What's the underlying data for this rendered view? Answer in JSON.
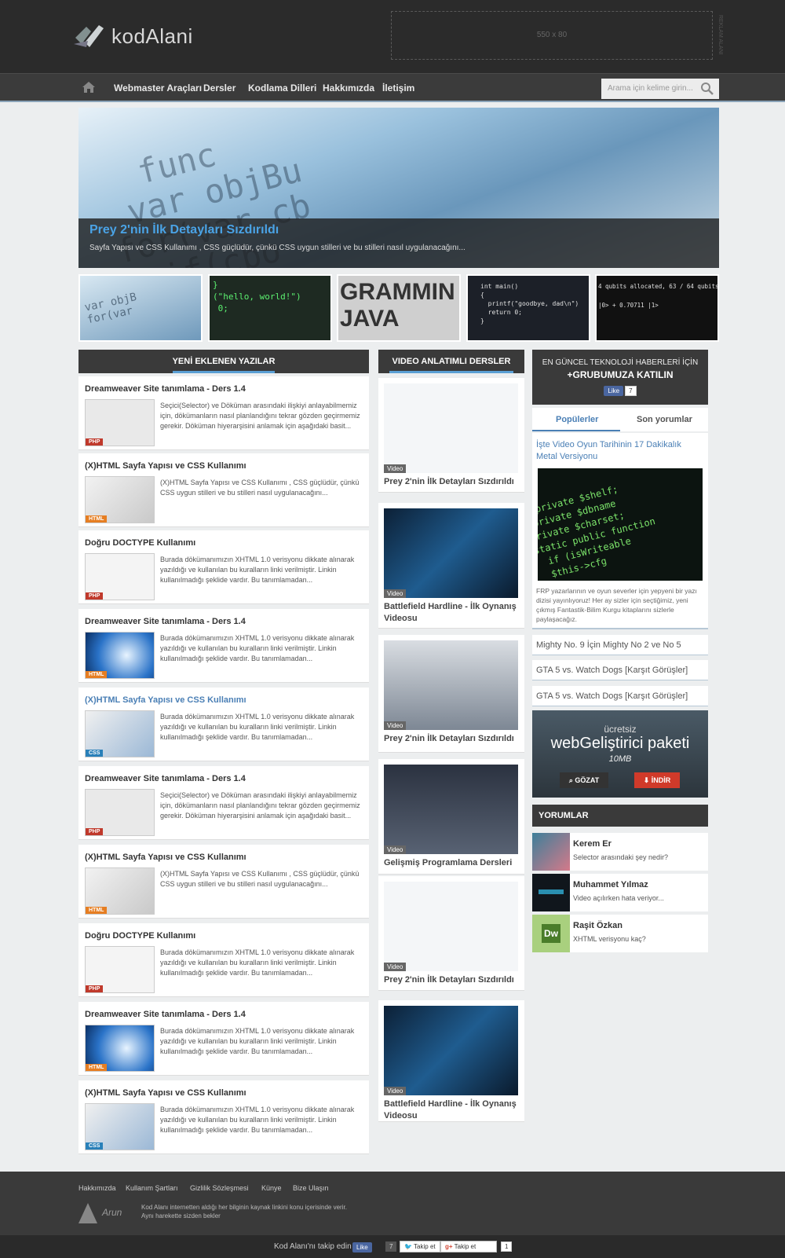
{
  "header": {
    "logo_text": "kodAlani",
    "ad_text": "550 x 80",
    "ad_side": "REKLAM ALANI"
  },
  "nav": {
    "items": [
      "Webmaster Araçları",
      "Dersler",
      "Kodlama Dilleri",
      "Hakkımızda",
      "İletişim"
    ],
    "search_placeholder": "Arama için kelime girin..."
  },
  "slider": {
    "title": "Prey 2'nin İlk Detayları Sızdırıldı",
    "desc": "Sayfa Yapısı ve CSS Kullanımı , CSS güçlüdür, çünkü CSS uygun stilleri ve bu stilleri nasıl uygulanacağını..."
  },
  "thumbs": [
    {
      "text": "var objB\nfor(var"
    },
    {
      "text": "}\n(\"hello, world!\")\n 0;"
    },
    {
      "text": "GRAMMIN\nJAVA"
    },
    {
      "text": "int main()\n{\n  printf(\"goodbye, dad\\n\")\n  return 0;\n}"
    },
    {
      "text": "4 qubits allocated, 63 / 64 qubits\n\n|0> + 0.70711 |1>"
    }
  ],
  "posts_panel": {
    "title": "YENİ EKLENEN YAZILAR"
  },
  "posts": [
    {
      "title": "Dreamweaver Site tanımlama - Ders 1.4",
      "desc": "Seçici(Selector) ve Döküman arasındaki ilişkiyi anlayabilmemiz için, dökümanların nasıl planlandığını tekrar gözden geçirmemiz gerekir. Döküman hiyerarşisini anlamak için aşağıdaki basit...",
      "tag": "PHP"
    },
    {
      "title": "(X)HTML Sayfa Yapısı ve CSS Kullanımı",
      "desc": "(X)HTML Sayfa Yapısı ve CSS Kullanımı , CSS güçlüdür, çünkü CSS uygun stilleri ve bu stilleri nasıl uygulanacağını...",
      "tag": "HTML"
    },
    {
      "title": "Doğru DOCTYPE Kullanımı",
      "desc": "Burada dökümanımızın XHTML 1.0 verisyonu dikkate alınarak yazıldığı ve kullanılan bu kuralların linki verilmiştir. Linkin kullanılmadığı şeklide vardır. Bu tanımlamadan...",
      "tag": "PHP"
    },
    {
      "title": "Dreamweaver Site tanımlama - Ders 1.4",
      "desc": "Burada dökümanımızın XHTML 1.0 verisyonu dikkate alınarak yazıldığı ve kullanılan bu kuralların linki verilmiştir. Linkin kullanılmadığı şeklide vardır. Bu tanımlamadan...",
      "tag": "HTML"
    },
    {
      "title": "(X)HTML Sayfa Yapısı ve CSS Kullanımı",
      "desc": "Burada dökümanımızın XHTML 1.0 verisyonu dikkate alınarak yazıldığı ve kullanılan bu kuralların linki verilmiştir. Linkin kullanılmadığı şeklide vardır. Bu tanımlamadan...",
      "tag": "CSS"
    },
    {
      "title": "Dreamweaver Site tanımlama - Ders 1.4",
      "desc": "Seçici(Selector) ve Döküman arasındaki ilişkiyi anlayabilmemiz için, dökümanların nasıl planlandığını tekrar gözden geçirmemiz gerekir. Döküman hiyerarşisini anlamak için aşağıdaki basit...",
      "tag": "PHP"
    },
    {
      "title": "(X)HTML Sayfa Yapısı ve CSS Kullanımı",
      "desc": "(X)HTML Sayfa Yapısı ve CSS Kullanımı , CSS güçlüdür, çünkü CSS uygun stilleri ve bu stilleri nasıl uygulanacağını...",
      "tag": "HTML"
    },
    {
      "title": "Doğru DOCTYPE Kullanımı",
      "desc": "Burada dökümanımızın XHTML 1.0 verisyonu dikkate alınarak yazıldığı ve kullanılan bu kuralların linki verilmiştir. Linkin kullanılmadığı şeklide vardır. Bu tanımlamadan...",
      "tag": "PHP"
    },
    {
      "title": "Dreamweaver Site tanımlama - Ders 1.4",
      "desc": "Burada dökümanımızın XHTML 1.0 verisyonu dikkate alınarak yazıldığı ve kullanılan bu kuralların linki verilmiştir. Linkin kullanılmadığı şeklide vardır. Bu tanımlamadan...",
      "tag": "HTML"
    },
    {
      "title": "(X)HTML Sayfa Yapısı ve CSS Kullanımı",
      "desc": "Burada dökümanımızın XHTML 1.0 verisyonu dikkate alınarak yazıldığı ve kullanılan bu kuralların linki verilmiştir. Linkin kullanılmadığı şeklide vardır. Bu tanımlamadan...",
      "tag": "CSS"
    }
  ],
  "video_panel": {
    "title": "VIDEO ANLATIMLI DERSLER",
    "label": "Video"
  },
  "videos": [
    {
      "title": "Prey 2'nin İlk Detayları Sızdırıldı"
    },
    {
      "title": "Battlefield Hardline - İlk Oynanış Videosu"
    },
    {
      "title": "Prey 2'nin İlk Detayları Sızdırıldı"
    },
    {
      "title": "Gelişmiş Programlama Dersleri"
    },
    {
      "title": "Prey 2'nin İlk Detayları Sızdırıldı"
    },
    {
      "title": "Battlefield Hardline - İlk Oynanış Videosu"
    }
  ],
  "sidebar": {
    "social_line1": "EN GÜNCEL TEKNOLOJİ HABERLERİ İÇİN",
    "social_line2": "+GRUBUMUZA KATILIN",
    "like_label": "Like",
    "like_count": "7",
    "tab_popular": "Popülerler",
    "tab_comments": "Son yorumlar",
    "featured_title": "İşte Video Oyun Tarihinin 17 Dakikalık Metal Versiyonu",
    "featured_desc": "FRP yazarlarının ve oyun severler için yepyeni bir yazı dizisi yayınlıyoruz! Her ay sizler için seçtiğimiz, yeni çıkmış Fantastik-Bilim Kurgu kitaplarını sizlerle paylaşacağız.",
    "links": [
      "Mighty No. 9 İçin Mighty No 2 ve No 5",
      "GTA 5 vs. Watch Dogs [Karşıt Görüşler]",
      "GTA 5 vs. Watch Dogs [Karşıt Görüşler]"
    ],
    "promo_small": "ücretsiz",
    "promo_big": "webGeliştirici paketi",
    "promo_size": "10MB",
    "promo_browse": "GÖZAT",
    "promo_download": "İNDİR",
    "comments_title": "YORUMLAR",
    "comments": [
      {
        "name": "Kerem Er",
        "text": "Selector arasındaki şey nedir?"
      },
      {
        "name": "Muhammet Yılmaz",
        "text": "Video açılırken hata veriyor..."
      },
      {
        "name": "Raşit Özkan",
        "text": "XHTML verisyonu kaç?"
      }
    ]
  },
  "footer": {
    "links": [
      "Hakkımızda",
      "Kullanım Şartları",
      "Gizlilik Sözleşmesi",
      "Künye",
      "Bize Ulaşın"
    ],
    "logo_text": "Arun",
    "note_line1": "Kod Alanı internetten aldığı her bilginin kaynak linkini konu içerisinde verir.",
    "note_line2": "Aynı harekette sizden bekler",
    "follow_text": "Kod Alanı'nı takip edin",
    "fb_label": "Like",
    "fb_count": "7",
    "tw_label": "Takip et",
    "gp_label": "Takip et",
    "gp_count": "1"
  },
  "colors": {
    "accent": "#4a7fb5",
    "php_tag": "#c0392b",
    "html_tag": "#e67e22",
    "css_tag": "#2980b9"
  }
}
